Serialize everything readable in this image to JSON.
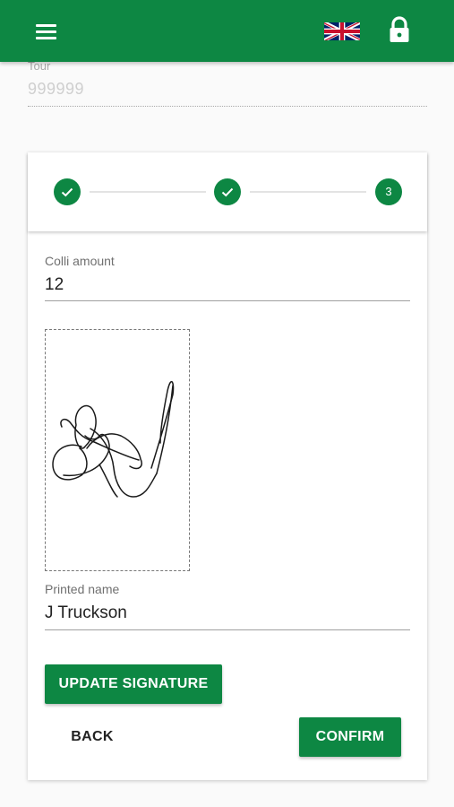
{
  "appbar": {
    "menu_icon": "hamburger-menu-icon",
    "language_icon": "uk-flag-icon",
    "lock_icon": "lock-icon",
    "color": "#0d8743"
  },
  "tour": {
    "label": "Tour",
    "placeholder": "999999"
  },
  "stepper": {
    "steps": [
      {
        "state": "completed",
        "icon": "check-icon"
      },
      {
        "state": "completed",
        "icon": "check-icon"
      },
      {
        "state": "active",
        "label": "3"
      }
    ]
  },
  "colli": {
    "label": "Colli amount",
    "value": "12"
  },
  "signature": {
    "icon": "signature-drawing"
  },
  "printed_name": {
    "label": "Printed name",
    "value": "J Truckson"
  },
  "actions": {
    "update_signature": "UPDATE SIGNATURE",
    "back": "BACK",
    "confirm": "CONFIRM"
  }
}
